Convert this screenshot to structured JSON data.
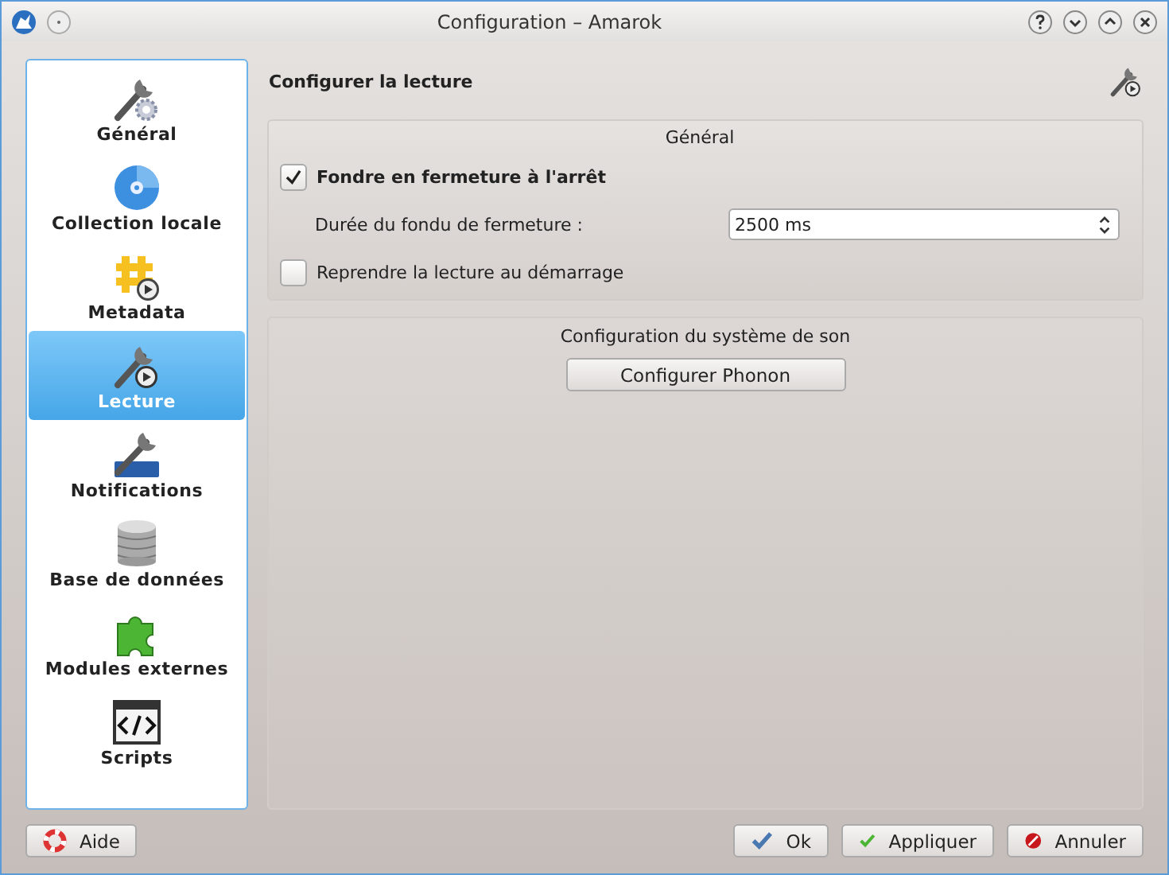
{
  "window": {
    "title": "Configuration – Amarok"
  },
  "sidebar": {
    "items": [
      {
        "label": "Général",
        "selected": false
      },
      {
        "label": "Collection locale",
        "selected": false
      },
      {
        "label": "Metadata",
        "selected": false
      },
      {
        "label": "Lecture",
        "selected": true
      },
      {
        "label": "Notifications",
        "selected": false
      },
      {
        "label": "Base de données",
        "selected": false
      },
      {
        "label": "Modules externes",
        "selected": false
      },
      {
        "label": "Scripts",
        "selected": false
      }
    ]
  },
  "page": {
    "title": "Configurer la lecture",
    "general": {
      "title": "Général",
      "fade": {
        "label": "Fondre en fermeture à l'arrêt",
        "checked": true
      },
      "duration": {
        "label": "Durée du fondu de fermeture :",
        "value": "2500 ms"
      },
      "resume": {
        "label": "Reprendre la lecture au démarrage",
        "checked": false
      }
    },
    "sound": {
      "title": "Configuration du système de son",
      "button": "Configurer Phonon"
    }
  },
  "buttons": {
    "help": "Aide",
    "ok": "Ok",
    "apply": "Appliquer",
    "cancel": "Annuler"
  }
}
